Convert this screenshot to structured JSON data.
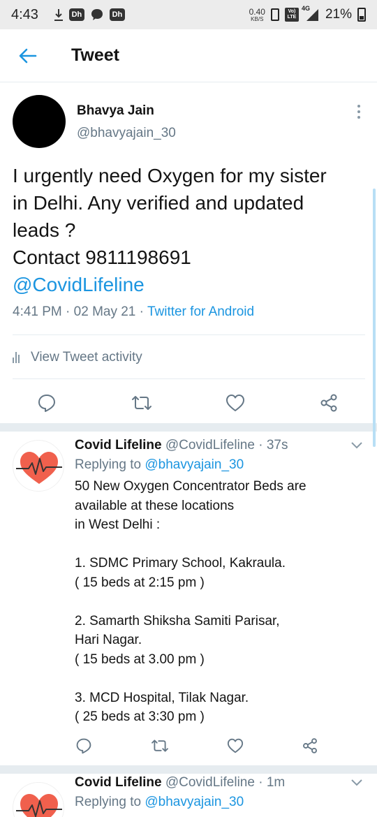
{
  "status_bar": {
    "time": "4:43",
    "chip1": "Dh",
    "chip2": "Dh",
    "speed_value": "0.40",
    "speed_unit": "KB/S",
    "volte_top": "Vo)",
    "volte_bottom": "LTE",
    "network": "4G",
    "battery": "21%"
  },
  "header": {
    "title": "Tweet",
    "back_icon": "arrow-left-icon"
  },
  "main_tweet": {
    "author_name": "Bhavya Jain",
    "author_handle": "@bhavyajain_30",
    "text_lines": [
      "I urgently need Oxygen for my sister",
      "in Delhi. Any verified and updated",
      "leads ?",
      "Contact 9811198691"
    ],
    "mention": "@CovidLifeline",
    "time": "4:41 PM",
    "sep1": " · ",
    "date": "02 May 21",
    "sep2": " · ",
    "source": "Twitter for Android",
    "activity_label": "View Tweet activity"
  },
  "replies": [
    {
      "name": "Covid Lifeline",
      "handle": "@CovidLifeline",
      "time": " · 37s",
      "replying_prefix": "Replying to ",
      "replying_to": "@bhavyajain_30",
      "body_lines": [
        "50 New Oxygen Concentrator Beds are",
        "available at these locations",
        "in West Delhi :",
        "",
        "1. SDMC Primary School, Kakraula.",
        "( 15 beds at 2:15 pm )",
        "",
        "2. Samarth Shiksha Samiti Parisar,",
        "Hari Nagar.",
        "( 15 beds at 3.00 pm )",
        "",
        "3. MCD Hospital, Tilak Nagar.",
        "( 25 beds at 3:30 pm )"
      ]
    },
    {
      "name": "Covid Lifeline",
      "handle": "@CovidLifeline",
      "time": " · 1m",
      "replying_prefix": "Replying to ",
      "replying_to": "@bhavyajain_30"
    }
  ],
  "colors": {
    "accent": "#1b95e0",
    "muted": "#657786",
    "heart": "#f0604d"
  }
}
